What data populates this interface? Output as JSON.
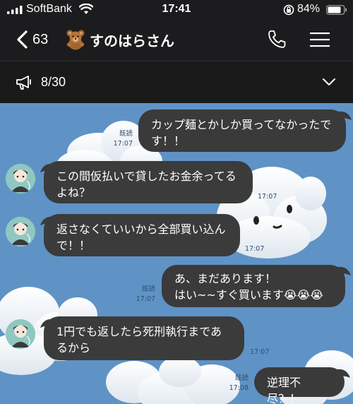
{
  "status_bar": {
    "carrier": "SoftBank",
    "time": "17:41",
    "battery": "84%"
  },
  "nav": {
    "back_count": "63",
    "title": "すのはらさん"
  },
  "announcement": {
    "count": "8/30"
  },
  "messages": [
    {
      "side": "out",
      "text": "カップ麺とかしか買ってなかったです！！",
      "read": "既読",
      "time": "17:07"
    },
    {
      "side": "in",
      "text": "この間仮払いで貸したお金余ってるよね？",
      "time": "17:07"
    },
    {
      "side": "in",
      "text": "返さなくていいから全部買い込んで！！",
      "time": "17:07"
    },
    {
      "side": "out",
      "line1": "あ、まだあります！",
      "line2": "はい~~すぐ買います😭😭😭",
      "read": "既読",
      "time": "17:07"
    },
    {
      "side": "in",
      "text": "1円でも返したら死刑執行まであるから",
      "time": "17:07"
    },
    {
      "side": "out",
      "text": "逆理不尽？！",
      "read": "既読",
      "time": "17:08"
    }
  ]
}
